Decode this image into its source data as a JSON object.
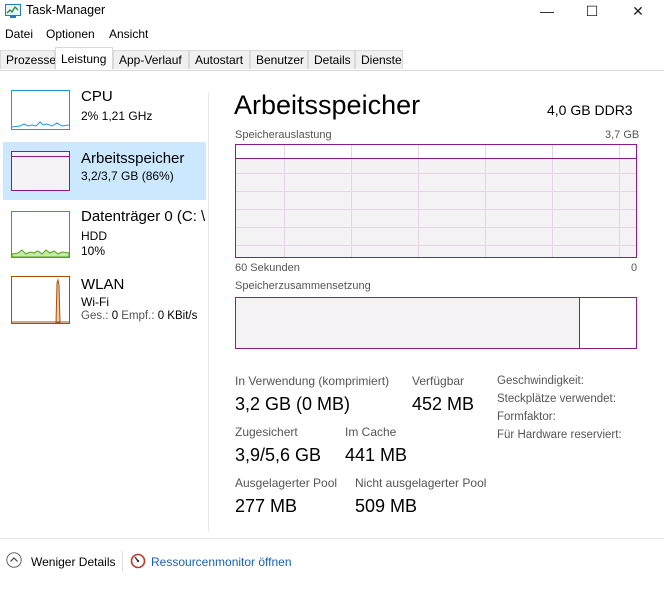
{
  "window": {
    "title": "Task-Manager",
    "minimize": "—",
    "maximize": "☐",
    "close": "✕"
  },
  "menu": [
    "Datei",
    "Optionen",
    "Ansicht"
  ],
  "tabs": [
    "Prozesse",
    "Leistung",
    "App-Verlauf",
    "Autostart",
    "Benutzer",
    "Details",
    "Dienste"
  ],
  "active_tab": "Leistung",
  "sidebar": {
    "items": [
      {
        "name": "CPU",
        "line1": "2%  1,21 GHz",
        "line2": "",
        "color": "#1b9ad6"
      },
      {
        "name": "Arbeitsspeicher",
        "line1": "3,2/3,7 GB (86%)",
        "line2": "",
        "color": "#8b1a8b",
        "selected": true
      },
      {
        "name": "Datenträger 0 (C: \\",
        "line1": "HDD",
        "line2": "10%",
        "color": "#4da60c"
      },
      {
        "name": "WLAN",
        "line1": "Wi-Fi",
        "line2_prefix": "Ges.: ",
        "line2_send": "0",
        "line2_mid": " Empf.: ",
        "line2_recv": "0 KBit/s",
        "color": "#a74f01"
      }
    ]
  },
  "memory": {
    "title": "Arbeitsspeicher",
    "spec": "4,0 GB DDR3",
    "usage_label": "Speicherauslastung",
    "usage_max": "3,7 GB",
    "time_left": "60 Sekunden",
    "time_right": "0",
    "composition_label": "Speicherzusammensetzung",
    "in_use_fraction": 0.86,
    "accent_color": "#8b1a8b",
    "stats": {
      "in_use_label": "In Verwendung (komprimiert)",
      "in_use_value": "3,2 GB (0 MB)",
      "available_label": "Verfügbar",
      "available_value": "452 MB",
      "committed_label": "Zugesichert",
      "committed_value": "3,9/5,6 GB",
      "cached_label": "Im Cache",
      "cached_value": "441 MB",
      "paged_label": "Ausgelagerter Pool",
      "paged_value": "277 MB",
      "nonpaged_label": "Nicht ausgelagerter Pool",
      "nonpaged_value": "509 MB"
    },
    "details": [
      "Geschwindigkeit:",
      "Steckplätze verwendet:",
      "Formfaktor:",
      "Für Hardware reserviert:"
    ]
  },
  "bottom": {
    "fewer_details": "Weniger Details",
    "resource_monitor": "Ressourcenmonitor öffnen"
  }
}
